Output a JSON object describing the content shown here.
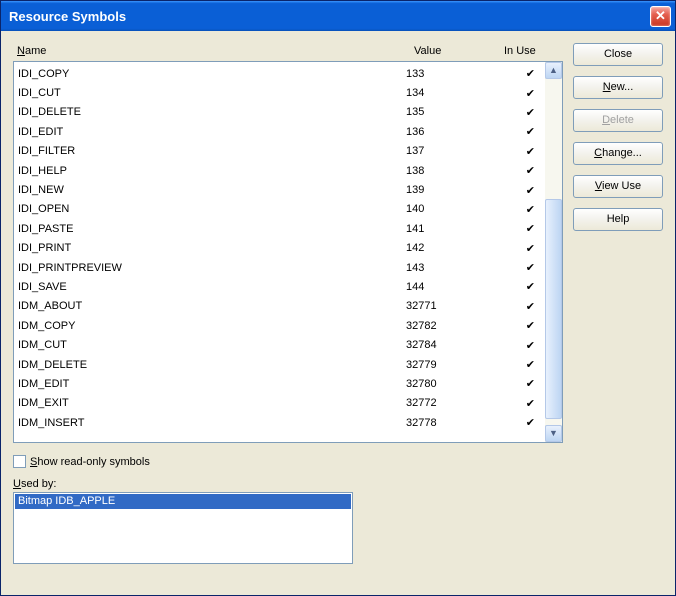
{
  "window": {
    "title": "Resource Symbols"
  },
  "columns": {
    "name": "Name",
    "value": "Value",
    "inuse": "In Use"
  },
  "symbols": [
    {
      "name": "IDI_COPY",
      "value": "133",
      "inuse": true
    },
    {
      "name": "IDI_CUT",
      "value": "134",
      "inuse": true
    },
    {
      "name": "IDI_DELETE",
      "value": "135",
      "inuse": true
    },
    {
      "name": "IDI_EDIT",
      "value": "136",
      "inuse": true
    },
    {
      "name": "IDI_FILTER",
      "value": "137",
      "inuse": true
    },
    {
      "name": "IDI_HELP",
      "value": "138",
      "inuse": true
    },
    {
      "name": "IDI_NEW",
      "value": "139",
      "inuse": true
    },
    {
      "name": "IDI_OPEN",
      "value": "140",
      "inuse": true
    },
    {
      "name": "IDI_PASTE",
      "value": "141",
      "inuse": true
    },
    {
      "name": "IDI_PRINT",
      "value": "142",
      "inuse": true
    },
    {
      "name": "IDI_PRINTPREVIEW",
      "value": "143",
      "inuse": true
    },
    {
      "name": "IDI_SAVE",
      "value": "144",
      "inuse": true
    },
    {
      "name": "IDM_ABOUT",
      "value": "32771",
      "inuse": true
    },
    {
      "name": "IDM_COPY",
      "value": "32782",
      "inuse": true
    },
    {
      "name": "IDM_CUT",
      "value": "32784",
      "inuse": true
    },
    {
      "name": "IDM_DELETE",
      "value": "32779",
      "inuse": true
    },
    {
      "name": "IDM_EDIT",
      "value": "32780",
      "inuse": true
    },
    {
      "name": "IDM_EXIT",
      "value": "32772",
      "inuse": true
    },
    {
      "name": "IDM_INSERT",
      "value": "32778",
      "inuse": true
    }
  ],
  "checkbox": {
    "label_pre": "S",
    "label_post": "how read-only symbols",
    "checked": false
  },
  "usedby": {
    "label_pre": "U",
    "label_post": "sed by:",
    "items": [
      "Bitmap IDB_APPLE"
    ]
  },
  "buttons": {
    "close": "Close",
    "new_pre": "N",
    "new_post": "ew...",
    "delete_pre": "D",
    "delete_post": "elete",
    "change_pre": "C",
    "change_post": "hange...",
    "viewuse_pre": "V",
    "viewuse_post": "iew Use",
    "help": "Help"
  }
}
